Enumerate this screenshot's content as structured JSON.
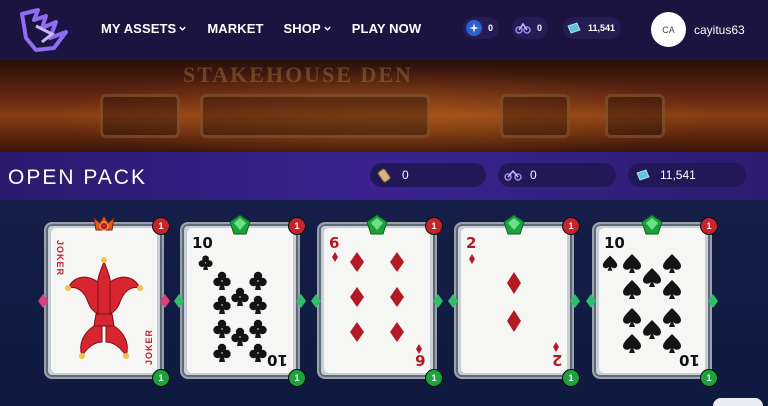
{
  "nav": {
    "menu": [
      {
        "label": "MY ASSETS",
        "dropdown": true
      },
      {
        "label": "MARKET",
        "dropdown": false
      },
      {
        "label": "SHOP",
        "dropdown": true
      },
      {
        "label": "PLAY NOW",
        "dropdown": false
      }
    ],
    "currencies": [
      {
        "icon": "star-token-icon",
        "value": "0"
      },
      {
        "icon": "bike-token-icon",
        "value": "0"
      },
      {
        "icon": "ticket-icon",
        "value": "11,541"
      }
    ],
    "avatar_initials": "CA",
    "username": "cayitus63"
  },
  "banner": {
    "sign_text": "STAKEHOUSE DEN"
  },
  "header": {
    "title": "OPEN PACK",
    "balances": [
      {
        "icon": "scroll-token-icon",
        "value": "0"
      },
      {
        "icon": "bike-token-icon",
        "value": "0"
      },
      {
        "icon": "ticket-icon",
        "value": "11,541"
      }
    ]
  },
  "cards": [
    {
      "rank": "JOKER",
      "suit": "joker",
      "gem": "legendary",
      "count_top": "1",
      "count_bottom": "1"
    },
    {
      "rank": "10",
      "suit": "clubs",
      "gem": "common",
      "count_top": "1",
      "count_bottom": "1"
    },
    {
      "rank": "6",
      "suit": "diamonds",
      "gem": "common",
      "count_top": "1",
      "count_bottom": "1"
    },
    {
      "rank": "2",
      "suit": "diamonds",
      "gem": "common",
      "count_top": "1",
      "count_bottom": "1"
    },
    {
      "rank": "10",
      "suit": "spades",
      "gem": "common",
      "count_top": "1",
      "count_bottom": "1"
    }
  ],
  "colors": {
    "nav_bg": "#1b1440",
    "header_bg": "#3a2390",
    "page_bg": "#101a3e",
    "red_suit": "#b21b24",
    "green_badge": "#1da33d",
    "red_badge": "#c5242c"
  }
}
